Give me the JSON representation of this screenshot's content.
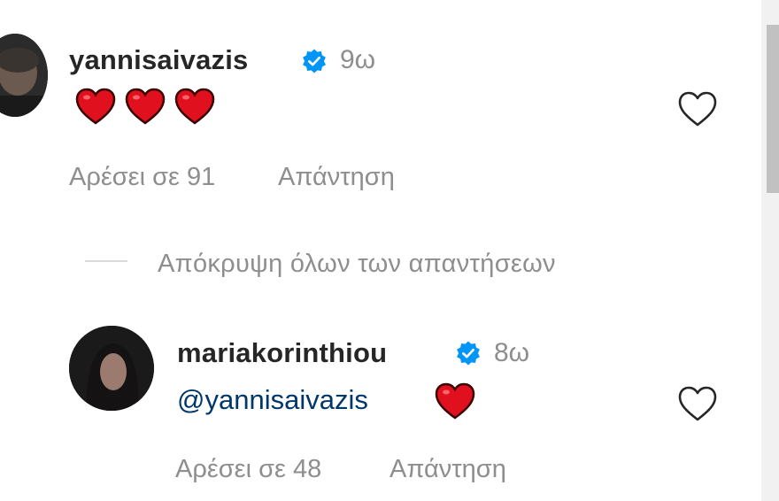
{
  "comments": [
    {
      "username": "yannisaivazis",
      "verified": true,
      "time": "9ω",
      "text": "",
      "emojis": [
        "red-heart",
        "red-heart",
        "red-heart"
      ],
      "likes_label": "Αρέσει σε 91",
      "reply_label": "Απάντηση"
    }
  ],
  "replies_toggle": {
    "label": "Απόκρυψη όλων των απαντήσεων"
  },
  "replies": [
    {
      "username": "mariakorinthiou",
      "verified": true,
      "time": "8ω",
      "text": "@yannisaivazis",
      "emojis": [
        "red-heart"
      ],
      "likes_label": "Αρέσει σε 48",
      "reply_label": "Απάντηση"
    }
  ],
  "colors": {
    "text_primary": "#262626",
    "text_secondary": "#8e8e8e",
    "mention": "#00376b",
    "verified_badge": "#0095f6",
    "heart_emoji": "#e0101e"
  }
}
